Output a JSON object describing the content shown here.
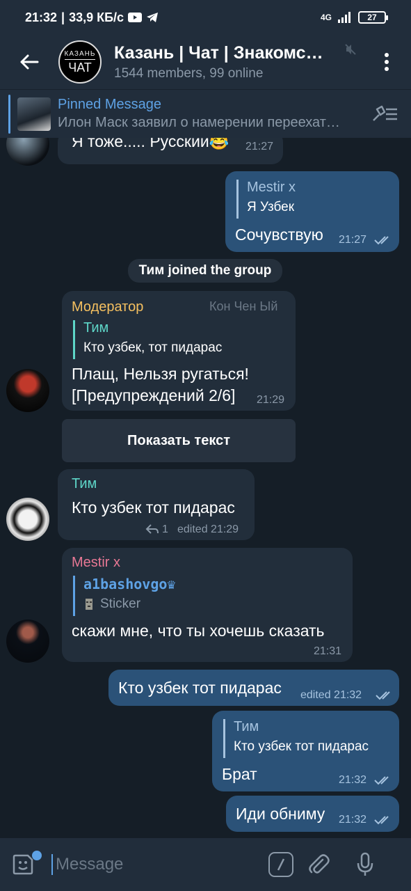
{
  "status": {
    "time": "21:32",
    "speed": "33,9 КБ/с",
    "network": "4G",
    "battery": "27"
  },
  "header": {
    "avatar_line1": "КАЗАНЬ",
    "avatar_line2": "ЧАТ",
    "title": "Казань | Чат | Знакомс…",
    "subtitle": "1544 members, 99 online"
  },
  "pinned": {
    "label": "Pinned Message",
    "text": "Илон Маск заявил о намерении переехат…"
  },
  "messages": {
    "m1": {
      "text": "Я тоже..... Русский😂",
      "time": "21:27"
    },
    "m2": {
      "reply_name": "Mestir x",
      "reply_text": "Я Узбек",
      "text": "Сочувствую",
      "time": "21:27"
    },
    "service": "Тим joined the group",
    "m3": {
      "sender": "Модератор",
      "badge": "Кон Чен Ый",
      "reply_name": "Тим",
      "reply_text": "Кто узбек, тот пидарас",
      "text1": "Плащ, Нельзя ругаться!",
      "text2": "[Предупреждений 2/6]",
      "time": "21:29"
    },
    "show_text_button": "Показать текст",
    "m4": {
      "sender": "Тим",
      "text": "Кто узбек тот пидарас",
      "replies": "1",
      "time": "edited 21:29"
    },
    "m5": {
      "sender": "Mestir x",
      "reply_name": "a1bashovgo♛",
      "reply_text": "Sticker",
      "text": "скажи мне, что ты хочешь сказать",
      "time": "21:31"
    },
    "m6": {
      "text": "Кто узбек тот пидарас",
      "time": "edited 21:32"
    },
    "m7": {
      "reply_name": "Тим",
      "reply_text": "Кто узбек тот пидарас",
      "text": "Брат",
      "time": "21:32"
    },
    "m8": {
      "text": "Иди обниму",
      "time": "21:32"
    }
  },
  "input": {
    "placeholder": "Message"
  },
  "colors": {
    "accent": "#5ea2e5",
    "moderator": "#f5c060",
    "tim": "#5ed6c8",
    "mestir": "#e87895",
    "outgoing": "#2b5278",
    "incoming": "#222e3b"
  }
}
